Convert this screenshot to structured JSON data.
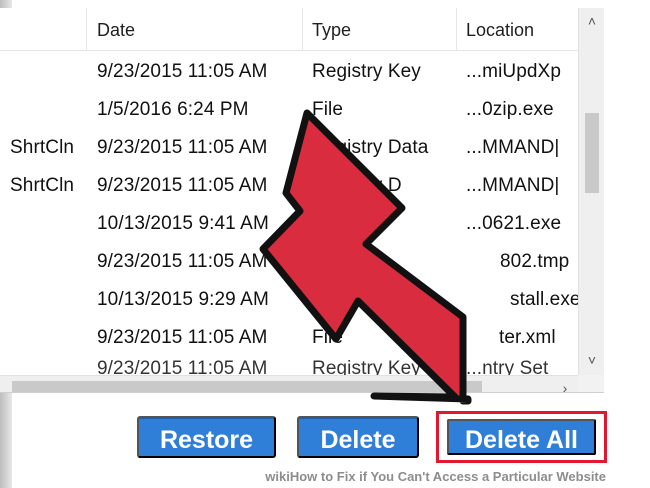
{
  "columns": {
    "date": "Date",
    "type": "Type",
    "location": "Location"
  },
  "rows": [
    {
      "name": "",
      "date": "9/23/2015 11:05 AM",
      "type": "Registry Key",
      "location": "...miUpdXp"
    },
    {
      "name": "",
      "date": "1/5/2016 6:24 PM",
      "type": "File",
      "location": "...0zip.exe"
    },
    {
      "name": "ShrtCln",
      "date": "9/23/2015 11:05 AM",
      "type": "Registry Data",
      "location": "...MMAND|"
    },
    {
      "name": "ShrtCln",
      "date": "9/23/2015 11:05 AM",
      "type": "Registry D",
      "location": "...MMAND|"
    },
    {
      "name": "",
      "date": "10/13/2015 9:41 AM",
      "type": "Fi",
      "location": "...0621.exe"
    },
    {
      "name": "",
      "date": "9/23/2015 11:05 AM",
      "type": "",
      "location": "802.tmp"
    },
    {
      "name": "",
      "date": "10/13/2015 9:29 AM",
      "type": "",
      "location": "stall.exe"
    },
    {
      "name": "",
      "date": "9/23/2015 11:05 AM",
      "type": "File",
      "location": "ter.xml"
    }
  ],
  "partial_row": {
    "date": "9/23/2015 11:05 AM",
    "type": "Registry Key",
    "location": "...ntry Set"
  },
  "buttons": {
    "restore": "Restore",
    "delete": "Delete",
    "delete_all": "Delete All"
  },
  "scrollbar": {
    "up_icon": "chevron-up-icon",
    "down_icon": "chevron-down-icon",
    "right_icon": "chevron-right-icon"
  },
  "footer": {
    "text": "wikiHow to Fix if You Can't Access a Particular Website"
  },
  "colors": {
    "button_blue": "#2f7fd9",
    "highlight_red": "#e1182f",
    "arrow_red": "#d92d3f",
    "arrow_outline": "#111111"
  }
}
